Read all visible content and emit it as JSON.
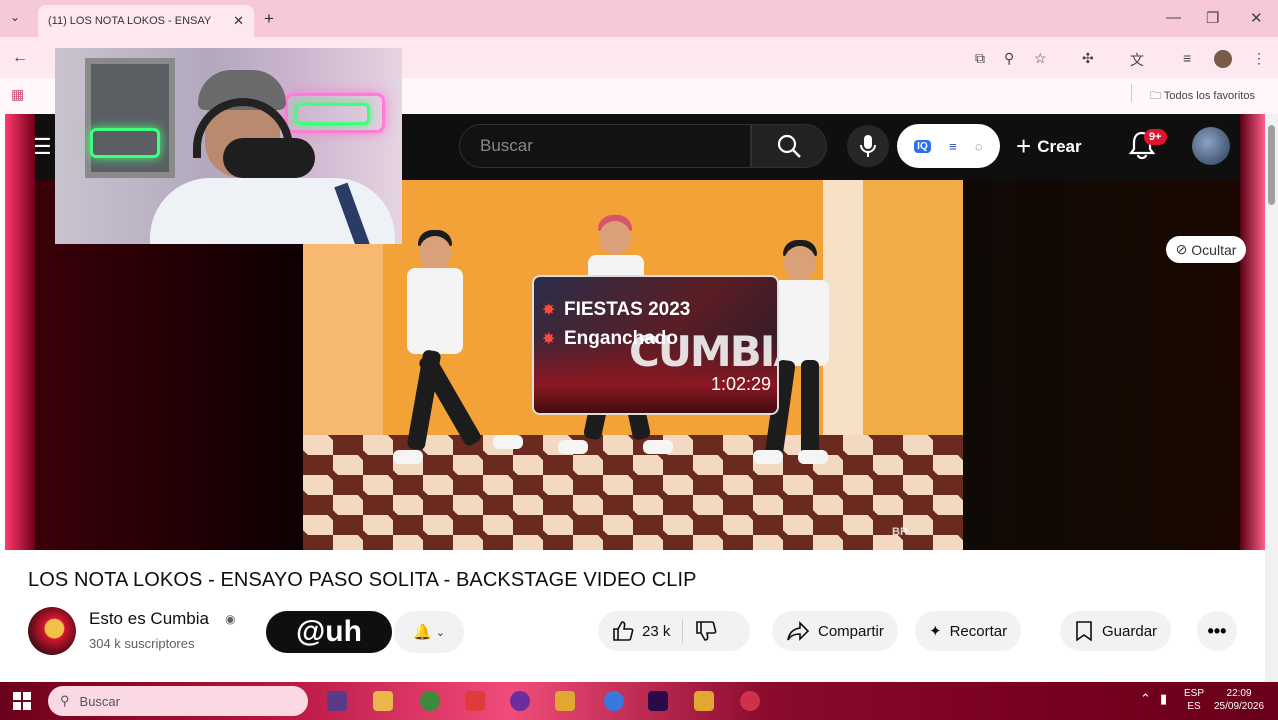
{
  "browser": {
    "tab_title": "(11) LOS NOTA LOKOS - ENSAY",
    "tab_close": "✕",
    "new_tab": "+",
    "tab_dropdown": "⌄",
    "window_controls": [
      "—",
      "❐",
      "✕"
    ],
    "bookmarks_folder": "Todos los favoritos"
  },
  "youtube": {
    "search_placeholder": "Buscar",
    "create_label": "Crear",
    "notification_badge": "9+",
    "hide_label": "Ocultar",
    "video_title": "LOS NOTA LOKOS - ENSAYO PASO SOLITA - BACKSTAGE VIDEO CLIP",
    "channel_name": "Esto es Cumbia",
    "subscribers": "304 k suscriptores",
    "subscribe_overlay": "@uh",
    "likes": "23 k",
    "share_label": "Compartir",
    "clip_label": "Recortar",
    "save_label": "Guardar",
    "more_label": "•••",
    "video_watermark": "BR"
  },
  "endscreen_card": {
    "line1": "FIESTAS 2023",
    "line2": "Enganchado",
    "big_text": "CUMBIAS",
    "duration": "1:02:29"
  },
  "taskbar": {
    "search_label": "Buscar",
    "lang_top": "ESP",
    "lang_bottom": "ES",
    "time": "22:09",
    "date": "25/09/2026"
  },
  "colors": {
    "browser_pink": "#f7c9d6",
    "yt_header": "#0f0f0f",
    "badge_red": "#e0152d",
    "taskbar_magenta": "#b3123d"
  }
}
